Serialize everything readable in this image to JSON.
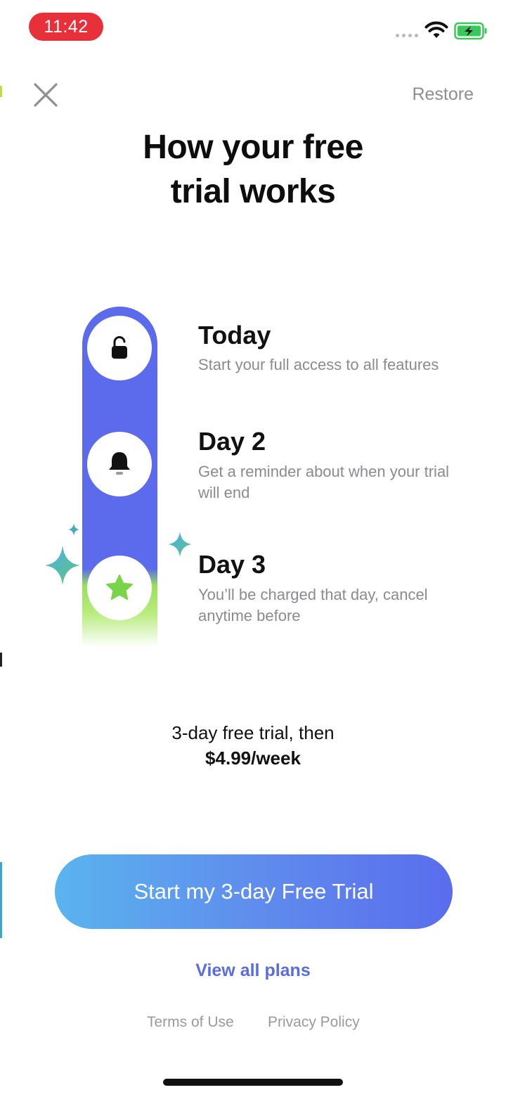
{
  "status_bar": {
    "time": "11:42"
  },
  "header": {
    "restore_label": "Restore",
    "title_line1": "How your free",
    "title_line2": "trial works"
  },
  "steps": [
    {
      "title": "Today",
      "description": "Start your full access to all features",
      "icon": "unlock-icon"
    },
    {
      "title": "Day 2",
      "description": "Get a reminder about when your trial will end",
      "icon": "bell-icon"
    },
    {
      "title": "Day 3",
      "description": "You’ll be charged that day, cancel anytime before",
      "icon": "star-icon"
    }
  ],
  "pricing": {
    "line1": "3-day free trial, then",
    "line2": "$4.99/week"
  },
  "cta": {
    "primary_label": "Start my 3-day Free Trial",
    "secondary_label": "View all plans"
  },
  "footer": {
    "terms_label": "Terms of Use",
    "privacy_label": "Privacy Policy"
  },
  "colors": {
    "timeline_blue": "#5b6bec",
    "timeline_green": "#99e05a",
    "cta_start": "#5ab4ef",
    "cta_end": "#5a6ded",
    "link": "#5a6dde",
    "status_pill": "#e8303a"
  }
}
